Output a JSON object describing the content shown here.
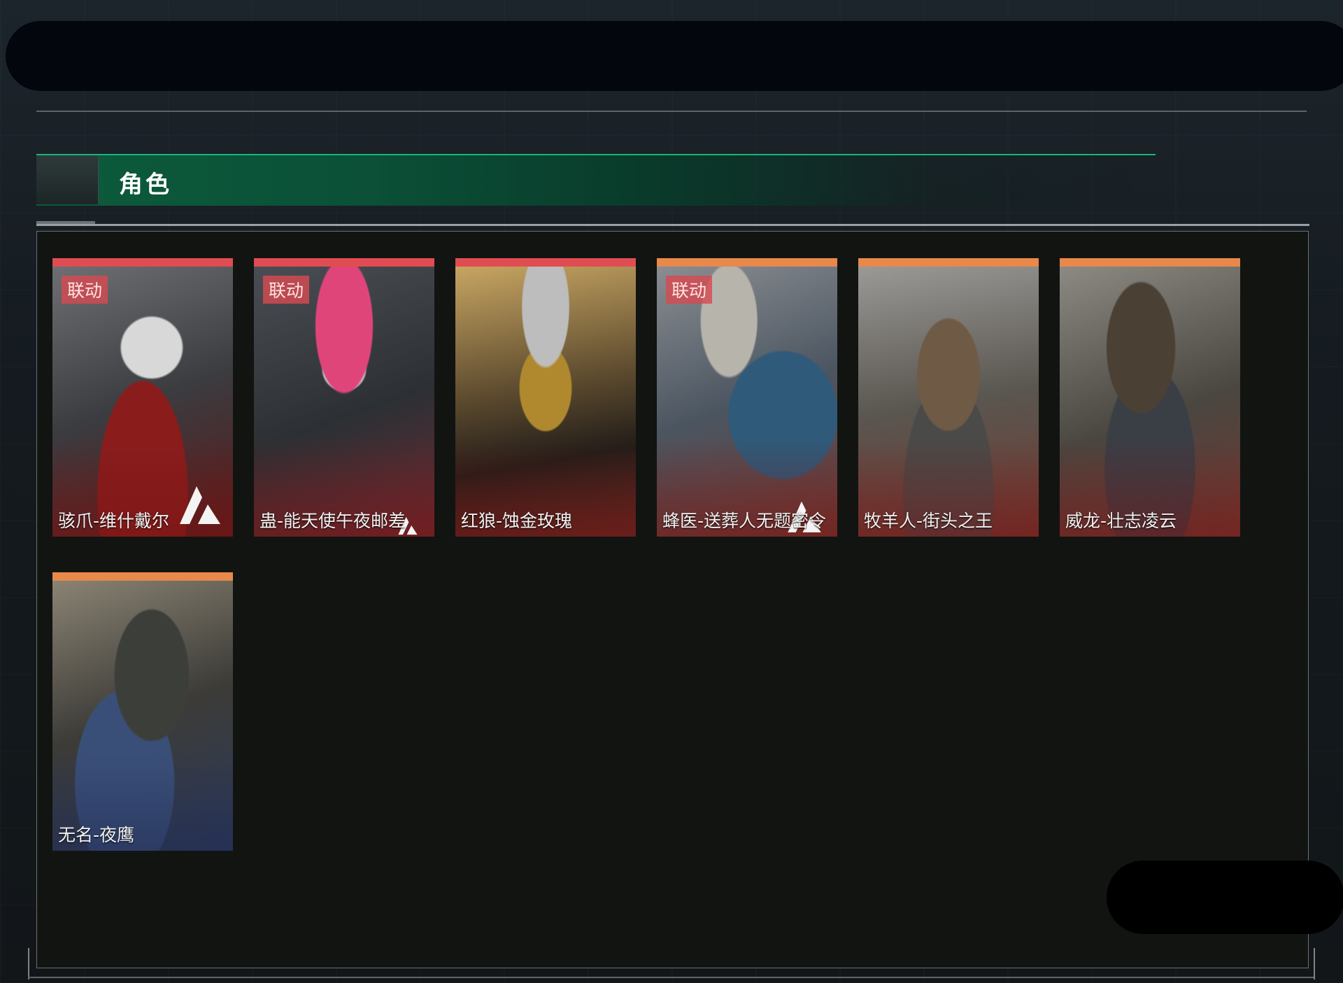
{
  "section": {
    "title": "角色"
  },
  "colors": {
    "red_bar": "#e04c52",
    "orange_bar": "#e8884a",
    "accent_green": "#17b777"
  },
  "characters": [
    {
      "name": "骇爪-维什戴尔",
      "badge": "联动",
      "bar": "red"
    },
    {
      "name": "蛊-能天使午夜邮差",
      "badge": "联动",
      "bar": "red"
    },
    {
      "name": "红狼-蚀金玫瑰",
      "badge": "",
      "bar": "red"
    },
    {
      "name": "蜂医-送葬人无题密令",
      "badge": "联动",
      "bar": "orange"
    },
    {
      "name": "牧羊人-街头之王",
      "badge": "",
      "bar": "orange"
    },
    {
      "name": "威龙-壮志凌云",
      "badge": "",
      "bar": "orange"
    },
    {
      "name": "无名-夜鹰",
      "badge": "",
      "bar": "orange"
    }
  ]
}
